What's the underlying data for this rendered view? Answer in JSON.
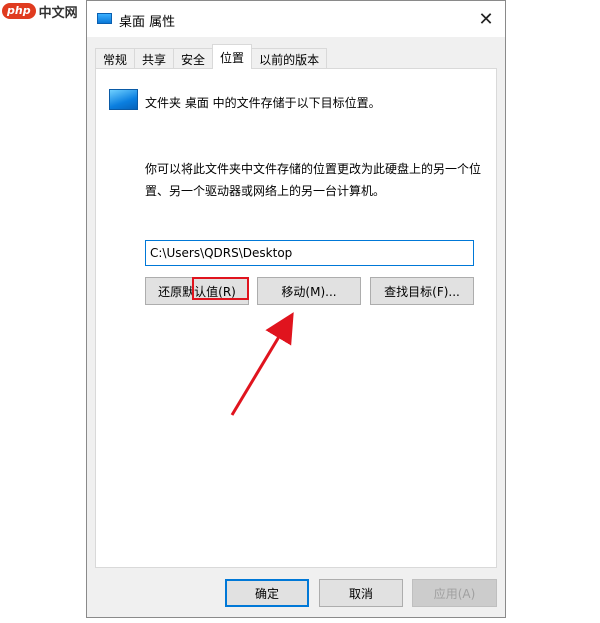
{
  "watermark": {
    "logo": "php",
    "text": "中文网"
  },
  "window": {
    "title": "桌面 属性",
    "close_glyph": "✕"
  },
  "tabs": [
    {
      "label": "常规"
    },
    {
      "label": "共享"
    },
    {
      "label": "安全"
    },
    {
      "label": "位置",
      "active": true
    },
    {
      "label": "以前的版本"
    }
  ],
  "location": {
    "folder_line": "文件夹 桌面 中的文件存储于以下目标位置。",
    "description": "你可以将此文件夹中文件存储的位置更改为此硬盘上的另一个位置、另一个驱动器或网络上的另一台计算机。",
    "path_value": "C:\\Users\\QDRS\\Desktop"
  },
  "buttons": {
    "restore": "还原默认值(R)",
    "move": "移动(M)...",
    "find": "查找目标(F)..."
  },
  "footer": {
    "ok": "确定",
    "cancel": "取消",
    "apply": "应用(A)"
  },
  "annotation": {
    "highlight_color": "#e0141e"
  }
}
